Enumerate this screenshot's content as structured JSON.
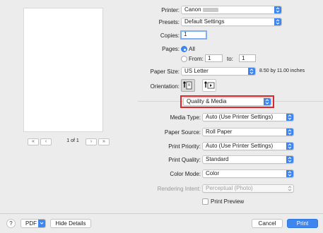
{
  "preview": {
    "first_label": "«",
    "prev_label": "‹",
    "page_indicator": "1 of 1",
    "next_label": "›",
    "last_label": "»"
  },
  "printer": {
    "label": "Printer:",
    "value": "Canon"
  },
  "presets": {
    "label": "Presets:",
    "value": "Default Settings"
  },
  "copies": {
    "label": "Copies:",
    "value": "1"
  },
  "pages": {
    "label": "Pages:",
    "all_label": "All",
    "from_label": "From:",
    "from_value": "1",
    "to_label": "to:",
    "to_value": "1",
    "selected": "all"
  },
  "paper_size": {
    "label": "Paper Size:",
    "value": "US Letter",
    "dimensions": "8.50 by 11.00 inches"
  },
  "orientation": {
    "label": "Orientation:",
    "selected": "portrait"
  },
  "panel_menu": {
    "value": "Quality & Media"
  },
  "media_type": {
    "label": "Media Type:",
    "value": "Auto (Use Printer Settings)"
  },
  "paper_source": {
    "label": "Paper Source:",
    "value": "Roll Paper"
  },
  "print_priority": {
    "label": "Print Priority:",
    "value": "Auto (Use Printer Settings)"
  },
  "print_quality": {
    "label": "Print Quality:",
    "value": "Standard"
  },
  "color_mode": {
    "label": "Color Mode:",
    "value": "Color"
  },
  "rendering_intent": {
    "label": "Rendering Intent:",
    "value": "Perceptual (Photo)",
    "enabled": false
  },
  "print_preview": {
    "label": "Print Preview",
    "checked": false
  },
  "footer": {
    "help_label": "?",
    "pdf_label": "PDF",
    "hide_details_label": "Hide Details",
    "cancel_label": "Cancel",
    "print_label": "Print"
  },
  "colors": {
    "accent": "#3d86f0",
    "highlight_border": "#e0262a",
    "background": "#ececec"
  }
}
